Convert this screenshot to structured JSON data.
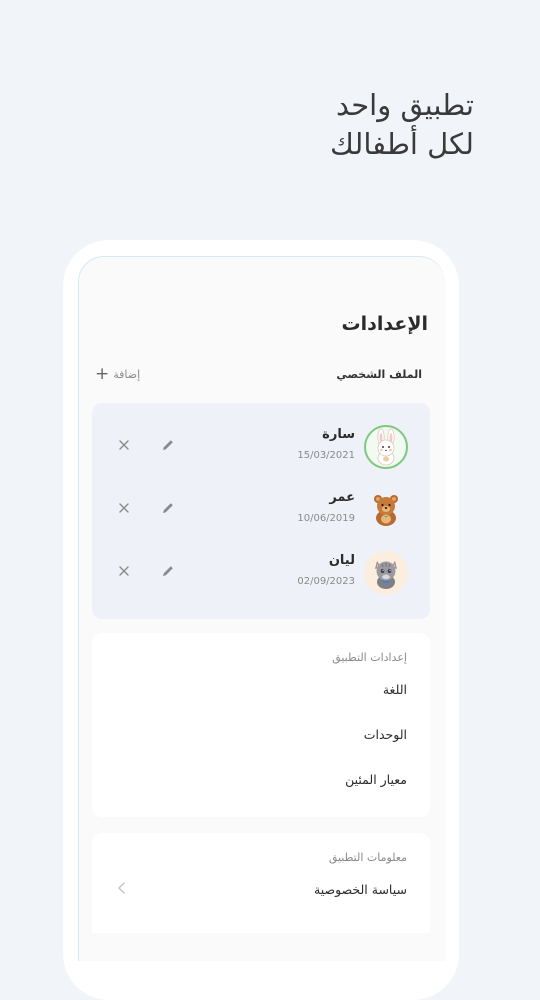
{
  "headline": {
    "line1": "تطبيق واحد",
    "line2": "لكل أطفالك"
  },
  "screen": {
    "title": "الإعدادات",
    "profile_label": "الملف الشخصي",
    "add_label": "إضافة",
    "add_icon": "+",
    "kids": [
      {
        "name": "سارة",
        "date": "15/03/2021",
        "avatar": "bunny-avatar"
      },
      {
        "name": "عمر",
        "date": "10/06/2019",
        "avatar": "bear-avatar"
      },
      {
        "name": "ليان",
        "date": "02/09/2023",
        "avatar": "cat-avatar"
      }
    ],
    "app_settings": {
      "title": "إعدادات التطبيق",
      "items": [
        "اللغة",
        "الوحدات",
        "معيار المئين"
      ]
    },
    "app_info": {
      "title": "معلومات التطبيق",
      "items": [
        "سياسة الخصوصية"
      ]
    }
  },
  "colors": {
    "background": "#f1f4f9",
    "kids_card": "#eef1f7",
    "avatar_ring": "#7bc97e",
    "muted_text": "#8a8a8a"
  }
}
